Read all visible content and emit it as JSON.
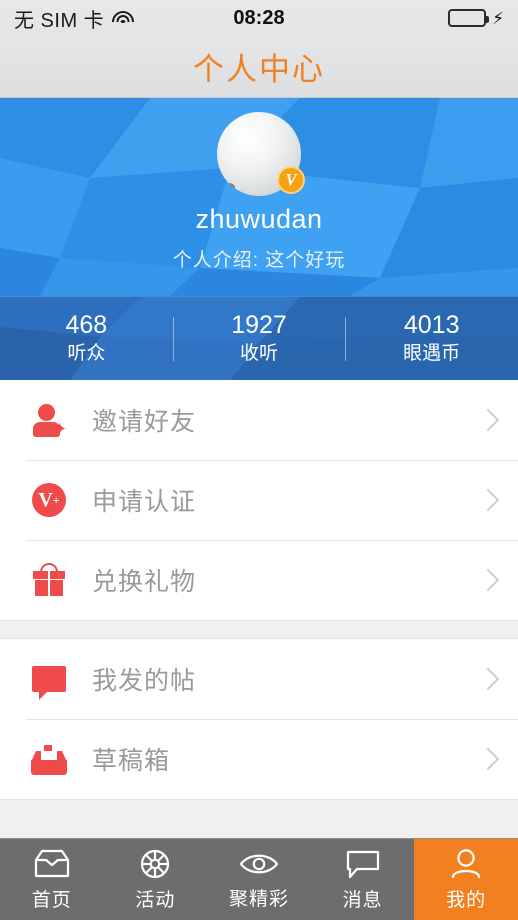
{
  "status_bar": {
    "carrier": "无 SIM 卡",
    "wifi_icon": "wifi-icon",
    "time": "08:28",
    "battery_icon": "battery-icon",
    "charging_icon": "lightning-bolt-icon",
    "battery_color": "#3ad24a"
  },
  "navbar": {
    "title": "个人中心",
    "title_color": "#f2801f"
  },
  "profile": {
    "avatar_name": "user-avatar",
    "verified_badge": "V",
    "username": "zhuwudan",
    "bio": "个人介绍: 这个好玩",
    "background_color": "#2f93e8"
  },
  "stats": [
    {
      "value": "468",
      "label": "听众"
    },
    {
      "value": "1927",
      "label": "收听"
    },
    {
      "value": "4013",
      "label": "眼遇币"
    }
  ],
  "menu_groups": [
    {
      "items": [
        {
          "label": "邀请好友",
          "icon": "person-add-icon"
        },
        {
          "label": "申请认证",
          "icon": "verify-v-icon"
        },
        {
          "label": "兑换礼物",
          "icon": "gift-icon"
        }
      ]
    },
    {
      "items": [
        {
          "label": "我发的帖",
          "icon": "chat-bubble-icon"
        },
        {
          "label": "草稿箱",
          "icon": "drafts-tray-icon"
        }
      ]
    }
  ],
  "chevron_icon": "chevron-right-icon",
  "icon_color": "#ef4b4b",
  "tabbar": {
    "active_color": "#f2801f",
    "background_color": "#6d6d6d",
    "tabs": [
      {
        "label": "首页",
        "icon": "home-inbox-icon",
        "active": false
      },
      {
        "label": "活动",
        "icon": "activity-wheel-icon",
        "active": false
      },
      {
        "label": "聚精彩",
        "icon": "eye-icon",
        "active": false
      },
      {
        "label": "消息",
        "icon": "message-bubble-icon",
        "active": false
      },
      {
        "label": "我的",
        "icon": "person-icon",
        "active": true
      }
    ]
  }
}
